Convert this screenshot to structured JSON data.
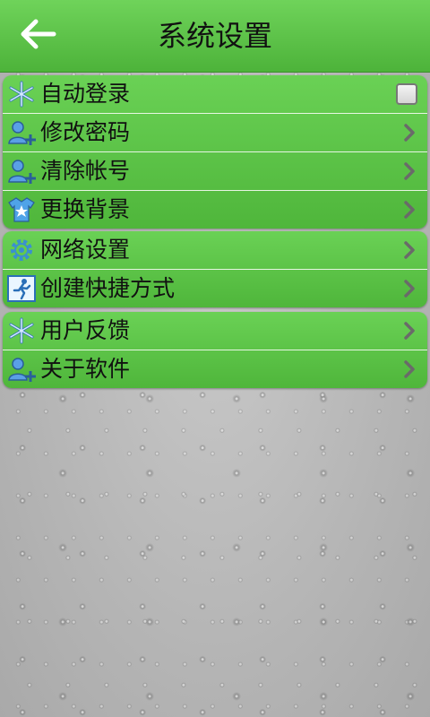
{
  "header": {
    "title": "系统设置",
    "back_icon": "arrow-left-icon"
  },
  "groups": [
    {
      "items": [
        {
          "label": "自动登录",
          "icon": "snowflake-icon",
          "control": "checkbox",
          "checked": false
        },
        {
          "label": "修改密码",
          "icon": "user-add-icon",
          "control": "chevron"
        },
        {
          "label": "清除帐号",
          "icon": "user-add-icon",
          "control": "chevron"
        },
        {
          "label": "更换背景",
          "icon": "star-shirt-icon",
          "control": "chevron"
        }
      ]
    },
    {
      "items": [
        {
          "label": "网络设置",
          "icon": "gear-icon",
          "control": "chevron"
        },
        {
          "label": "创建快捷方式",
          "icon": "run-shortcut-icon",
          "control": "chevron"
        }
      ]
    },
    {
      "items": [
        {
          "label": "用户反馈",
          "icon": "snowflake-icon",
          "control": "chevron"
        },
        {
          "label": "关于软件",
          "icon": "user-add-icon",
          "control": "chevron"
        }
      ]
    }
  ],
  "colors": {
    "accent_green": "#4db33a",
    "text": "#111111"
  }
}
